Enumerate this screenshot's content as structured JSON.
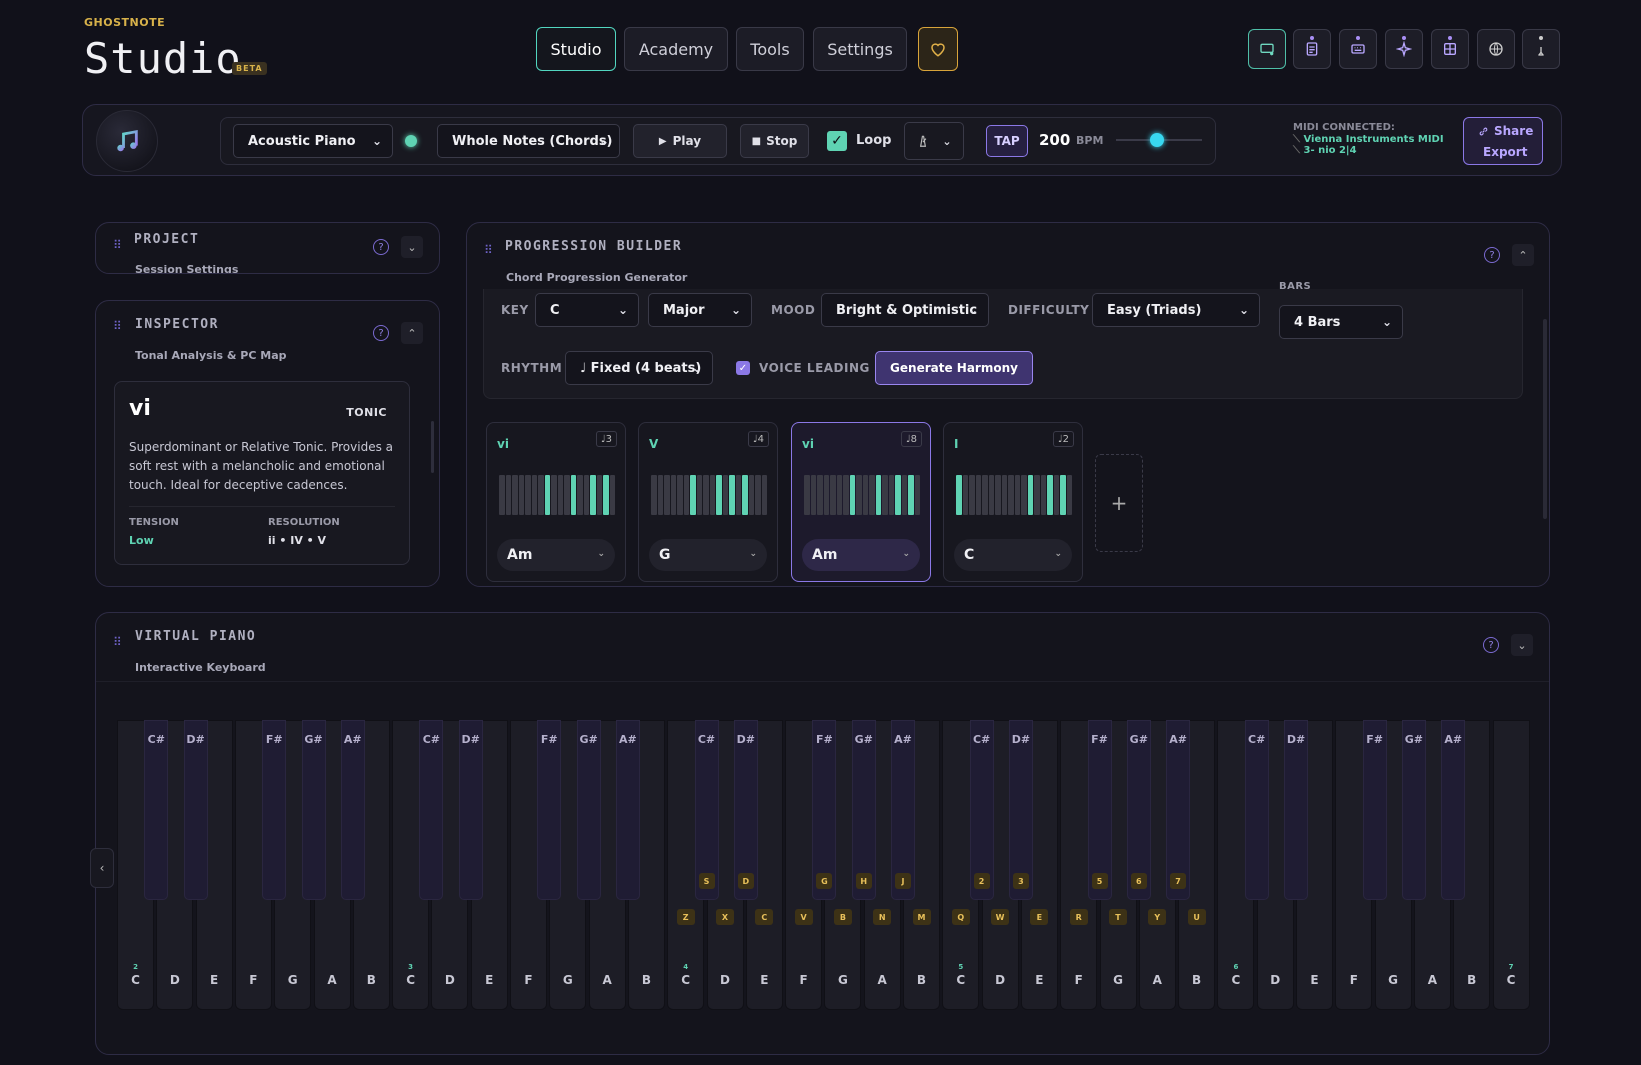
{
  "brand": {
    "small": "GHOSTNOTE",
    "name": "Studio",
    "badge": "BETA"
  },
  "nav": {
    "tabs": [
      "Studio",
      "Academy",
      "Tools",
      "Settings"
    ],
    "active": "Studio"
  },
  "toolbar": {
    "instrument": "Acoustic Piano",
    "pattern": "Whole Notes (Chords)",
    "play_label": "Play",
    "stop_label": "Stop",
    "loop_label": "Loop",
    "loop_checked": true,
    "tap_label": "TAP",
    "bpm_value": "200",
    "bpm_unit": "BPM",
    "midi_title": "MIDI CONNECTED:",
    "midi_device_1": "Vienna Instruments MIDI",
    "midi_device_2": "3- nio 2|4",
    "share_label": "Share",
    "export_label": "Export"
  },
  "project": {
    "title": "PROJECT",
    "subtitle": "Session Settings"
  },
  "inspector": {
    "title": "INSPECTOR",
    "subtitle": "Tonal Analysis & PC Map",
    "numeral": "vi",
    "function": "TONIC",
    "description": "Superdominant or Relative Tonic. Provides a soft rest with a melancholic and emotional touch. Ideal for deceptive cadences.",
    "tension_label": "TENSION",
    "tension_value": "Low",
    "resolution_label": "RESOLUTION",
    "resolution_value": "ii • IV • V"
  },
  "progression": {
    "title": "PROGRESSION BUILDER",
    "subtitle": "Chord Progression Generator",
    "key_label": "KEY",
    "key_value": "C",
    "mode_value": "Major",
    "mood_label": "MOOD",
    "mood_value": "Bright & Optimistic",
    "difficulty_label": "DIFFICULTY",
    "difficulty_value": "Easy (Triads)",
    "bars_label": "BARS",
    "bars_value": "4 Bars",
    "rhythm_label": "RHYTHM",
    "rhythm_value": "♩ Fixed (4 beats)",
    "voice_leading_label": "VOICE LEADING",
    "generate_label": "Generate Harmony",
    "add_label": "+",
    "chords": [
      {
        "numeral": "vi",
        "badge": "♩3",
        "name": "Am",
        "keys": [
          7,
          11,
          14,
          16
        ]
      },
      {
        "numeral": "V",
        "badge": "♩4",
        "name": "G",
        "keys": [
          6,
          10,
          12,
          14
        ]
      },
      {
        "numeral": "vi",
        "badge": "♩8",
        "name": "Am",
        "keys": [
          7,
          11,
          14,
          16
        ],
        "active": true
      },
      {
        "numeral": "I",
        "badge": "♩2",
        "name": "C",
        "keys": [
          0,
          11,
          14,
          16
        ]
      }
    ]
  },
  "piano": {
    "title": "VIRTUAL PIANO",
    "subtitle": "Interactive Keyboard",
    "white_keys": [
      {
        "n": "C",
        "oct": "2"
      },
      {
        "n": "D"
      },
      {
        "n": "E"
      },
      {
        "n": "F"
      },
      {
        "n": "G"
      },
      {
        "n": "A"
      },
      {
        "n": "B"
      },
      {
        "n": "C",
        "oct": "3"
      },
      {
        "n": "D"
      },
      {
        "n": "E"
      },
      {
        "n": "F"
      },
      {
        "n": "G"
      },
      {
        "n": "A"
      },
      {
        "n": "B"
      },
      {
        "n": "C",
        "oct": "4",
        "hk": "Z"
      },
      {
        "n": "D",
        "hk": "X"
      },
      {
        "n": "E",
        "hk": "C"
      },
      {
        "n": "F",
        "hk": "V"
      },
      {
        "n": "G",
        "hk": "B"
      },
      {
        "n": "A",
        "hk": "N"
      },
      {
        "n": "B",
        "hk": "M"
      },
      {
        "n": "C",
        "oct": "5",
        "hk": "Q"
      },
      {
        "n": "D",
        "hk": "W"
      },
      {
        "n": "E",
        "hk": "E"
      },
      {
        "n": "F",
        "hk": "R"
      },
      {
        "n": "G",
        "hk": "T"
      },
      {
        "n": "A",
        "hk": "Y"
      },
      {
        "n": "B",
        "hk": "U"
      },
      {
        "n": "C",
        "oct": "6"
      },
      {
        "n": "D"
      },
      {
        "n": "E"
      },
      {
        "n": "F"
      },
      {
        "n": "G"
      },
      {
        "n": "A"
      },
      {
        "n": "B"
      },
      {
        "n": "C",
        "oct": "7"
      }
    ],
    "black_keys": [
      {
        "n": "C#",
        "after": 0
      },
      {
        "n": "D#",
        "after": 1
      },
      {
        "n": "F#",
        "after": 3
      },
      {
        "n": "G#",
        "after": 4
      },
      {
        "n": "A#",
        "after": 5
      },
      {
        "n": "C#",
        "after": 7
      },
      {
        "n": "D#",
        "after": 8
      },
      {
        "n": "F#",
        "after": 10
      },
      {
        "n": "G#",
        "after": 11
      },
      {
        "n": "A#",
        "after": 12
      },
      {
        "n": "C#",
        "after": 14,
        "hk": "S"
      },
      {
        "n": "D#",
        "after": 15,
        "hk": "D"
      },
      {
        "n": "F#",
        "after": 17,
        "hk": "G"
      },
      {
        "n": "G#",
        "after": 18,
        "hk": "H"
      },
      {
        "n": "A#",
        "after": 19,
        "hk": "J"
      },
      {
        "n": "C#",
        "after": 21,
        "hk": "2"
      },
      {
        "n": "D#",
        "after": 22,
        "hk": "3"
      },
      {
        "n": "F#",
        "after": 24,
        "hk": "5"
      },
      {
        "n": "G#",
        "after": 25,
        "hk": "6"
      },
      {
        "n": "A#",
        "after": 26,
        "hk": "7"
      },
      {
        "n": "C#",
        "after": 28
      },
      {
        "n": "D#",
        "after": 29
      },
      {
        "n": "F#",
        "after": 31
      },
      {
        "n": "G#",
        "after": 32
      },
      {
        "n": "A#",
        "after": 33
      }
    ]
  },
  "colors": {
    "accent": "#5fd3b3",
    "purple": "#8b78e6",
    "gold": "#d8a43a"
  }
}
